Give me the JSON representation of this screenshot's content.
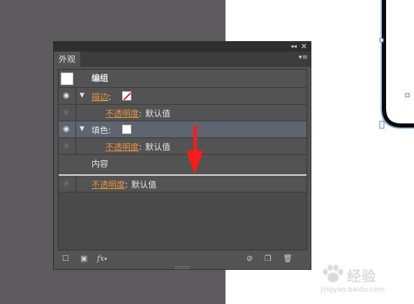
{
  "panel": {
    "tab_label": "外观",
    "collapse_glyph": "◂◂",
    "close_glyph": "✕",
    "menu_glyph": "▾≡"
  },
  "rows": {
    "group": {
      "label": "编组"
    },
    "stroke": {
      "label": "描边",
      "colon": ":"
    },
    "stroke_opacity": {
      "label": "不透明度",
      "colon": ":",
      "value": "默认值"
    },
    "fill": {
      "label": "填色",
      "colon": ":"
    },
    "fill_opacity": {
      "label": "不透明度",
      "colon": ":",
      "value": "默认值"
    },
    "contents": {
      "label": "内容"
    },
    "object_opacity": {
      "label": "不透明度",
      "colon": ":",
      "value": "默认值"
    }
  },
  "footer": {
    "fx_label": "fx"
  },
  "watermark": {
    "brand": "经验",
    "url": "jingyan.baidu.com"
  },
  "colors": {
    "accent_orange": "#e8933a",
    "arrow_red": "#ff1a1a",
    "panel_bg": "#535353",
    "selected_row": "#5e6570"
  }
}
